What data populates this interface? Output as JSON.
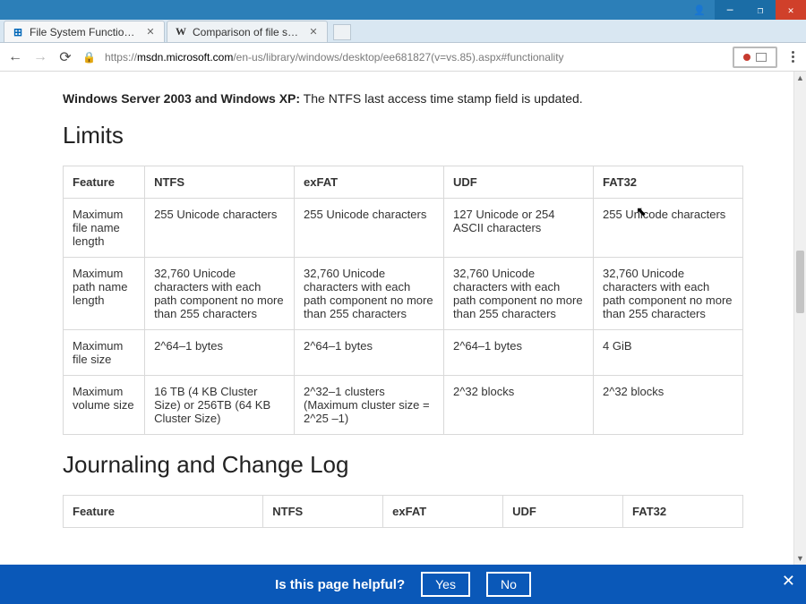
{
  "window": {
    "close": "✕",
    "max": "❐",
    "min": "─",
    "user_icon": "👤"
  },
  "tabs": [
    {
      "favicon": "⊞",
      "title": "File System Functionality",
      "close": "✕"
    },
    {
      "favicon": "W",
      "title": "Comparison of file syste",
      "close": "✕"
    }
  ],
  "newtab": " ",
  "toolbar": {
    "back": "←",
    "fwd": "→",
    "reload": "⟳",
    "padlock": "🔒",
    "url_scheme": "https://",
    "url_host": "msdn.microsoft.com",
    "url_path": "/en-us/library/windows/desktop/ee681827(v=vs.85).aspx#functionality"
  },
  "page": {
    "intro_bold": "Windows Server 2003 and Windows XP:",
    "intro_rest": "  The NTFS last access time stamp field is updated.",
    "section_limits": "Limits",
    "section_journal": "Journaling and Change Log",
    "limits_headers": [
      "Feature",
      "NTFS",
      "exFAT",
      "UDF",
      "FAT32"
    ],
    "limits_rows": [
      [
        "Maximum file name length",
        "255 Unicode characters",
        "255 Unicode characters",
        "127 Unicode or 254 ASCII characters",
        "255 Unicode characters"
      ],
      [
        "Maximum path name length",
        "32,760 Unicode characters with each path component no more than 255 characters",
        "32,760 Unicode characters with each path component no more than 255 characters",
        "32,760 Unicode characters with each path component no more than 255 characters",
        "32,760 Unicode characters with each path component no more than 255 characters"
      ],
      [
        "Maximum file size",
        "2^64–1 bytes",
        "2^64–1 bytes",
        "2^64–1 bytes",
        "4 GiB"
      ],
      [
        "Maximum volume size",
        "16 TB (4 KB Cluster Size) or 256TB (64 KB Cluster Size)",
        "2^32–1 clusters (Maximum cluster size = 2^25 –1)",
        "2^32 blocks",
        "2^32 blocks"
      ]
    ],
    "journal_headers": [
      "Feature",
      "NTFS",
      "exFAT",
      "UDF",
      "FAT32"
    ]
  },
  "feedback": {
    "question": "Is this page helpful?",
    "yes": "Yes",
    "no": "No",
    "close": "✕"
  }
}
